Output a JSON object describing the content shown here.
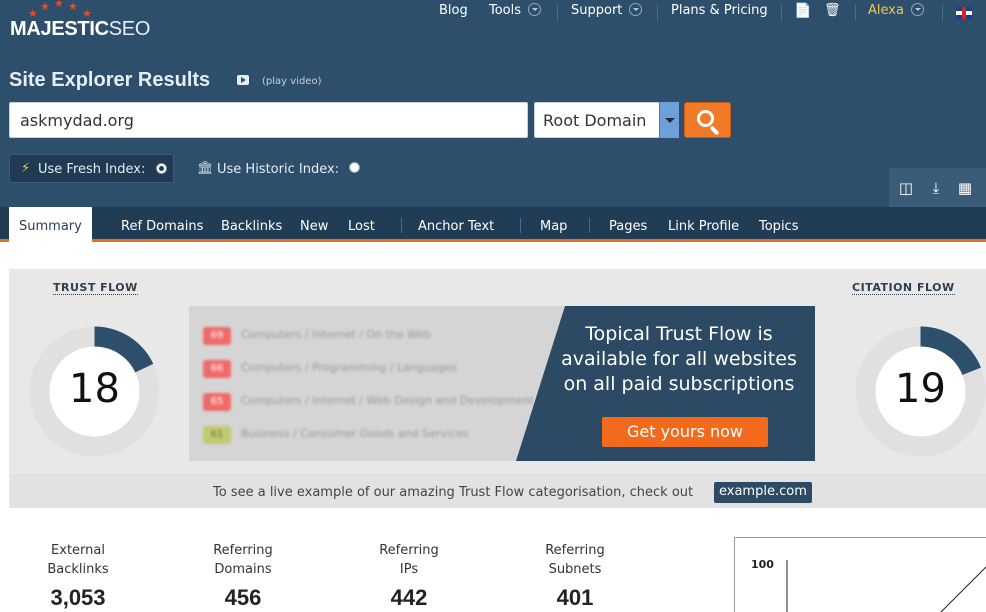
{
  "brand": {
    "name_bold": "MAJESTIC",
    "name_light": "SEO"
  },
  "topnav": {
    "blog": "Blog",
    "tools": "Tools",
    "support": "Support",
    "plans": "Plans & Pricing",
    "user": "Alexa"
  },
  "page": {
    "title": "Site Explorer Results",
    "play_video": "(play video)"
  },
  "search": {
    "value": "askmydad.org",
    "scope": "Root Domain"
  },
  "index": {
    "fresh_label": "Use Fresh Index:",
    "historic_label": "Use Historic Index:",
    "selected": "fresh"
  },
  "tabs": [
    "Summary",
    "Ref Domains",
    "Backlinks",
    "New",
    "Lost",
    "Anchor Text",
    "Map",
    "Pages",
    "Link Profile",
    "Topics"
  ],
  "trust_flow": {
    "label": "TRUST FLOW",
    "value": "18",
    "fraction": 0.18
  },
  "citation_flow": {
    "label": "CITATION FLOW",
    "value": "19",
    "fraction": 0.19
  },
  "teaser": {
    "rows": [
      {
        "score": "69",
        "topic": "Computers / Internet / On the Web",
        "color": "#f06a6a"
      },
      {
        "score": "66",
        "topic": "Computers / Programming / Languages",
        "color": "#f06a6a"
      },
      {
        "score": "65",
        "topic": "Computers / Internet / Web Design and Development",
        "color": "#f06a6a"
      },
      {
        "score": "61",
        "topic": "Business / Consumer Goods and Services",
        "color": "#c2c872"
      }
    ],
    "headline": "Topical Trust Flow is available for all websites on all paid subscriptions",
    "cta": "Get yours now"
  },
  "example": {
    "text": "To see a live example of our amazing Trust Flow categorisation, check out",
    "link": "example.com"
  },
  "stats": [
    {
      "label": "External\nBacklinks",
      "value": "3,053"
    },
    {
      "label": "Referring\nDomains",
      "value": "456"
    },
    {
      "label": "Referring\nIPs",
      "value": "442"
    },
    {
      "label": "Referring\nSubnets",
      "value": "401"
    }
  ],
  "mini_chart": {
    "y_tick": "100"
  },
  "colors": {
    "header": "#2e4f6b",
    "tabbar": "#213d56",
    "accent": "#f07a28",
    "gauge": "#2e4f6b"
  }
}
